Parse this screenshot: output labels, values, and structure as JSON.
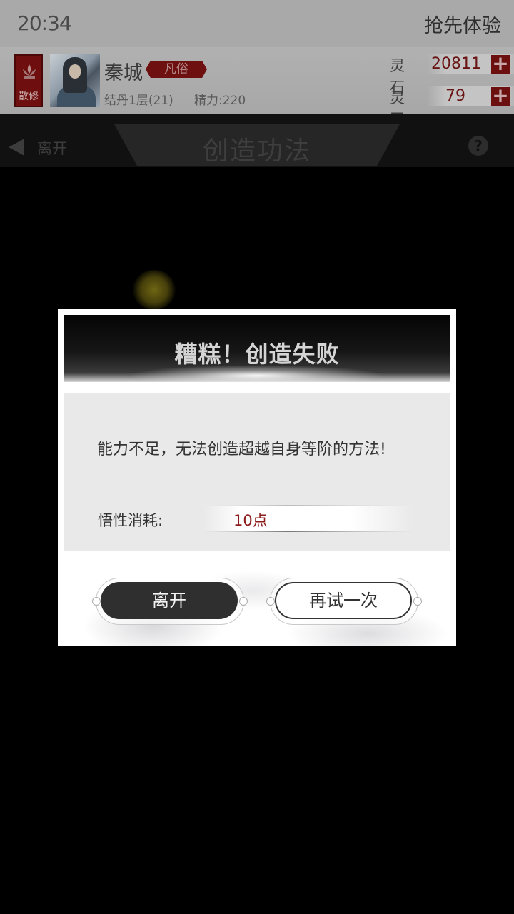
{
  "status_bar": {
    "time": "20:34",
    "preview_label": "抢先体验"
  },
  "player": {
    "sect_badge": "散修",
    "name": "秦城",
    "rank": "凡俗",
    "realm": "结丹1层(21)",
    "energy": "精力:220"
  },
  "resources": [
    {
      "label": "灵石",
      "value": "20811",
      "add_icon": "plus-icon"
    },
    {
      "label": "灵玉",
      "value": "79",
      "add_icon": "plus-icon"
    }
  ],
  "nav": {
    "back_label": "离开",
    "title": "创造功法",
    "help_icon": "?"
  },
  "dialog": {
    "title": "糟糕！创造失败",
    "message": "能力不足，无法创造超越自身等阶的方法!",
    "cost_label": "悟性消耗:",
    "cost_value": "10点",
    "leave_button": "离开",
    "retry_button": "再试一次"
  },
  "colors": {
    "accent_red": "#6f1010",
    "cost_red": "#8b1a1a",
    "dark_button": "#2f2f2f"
  }
}
